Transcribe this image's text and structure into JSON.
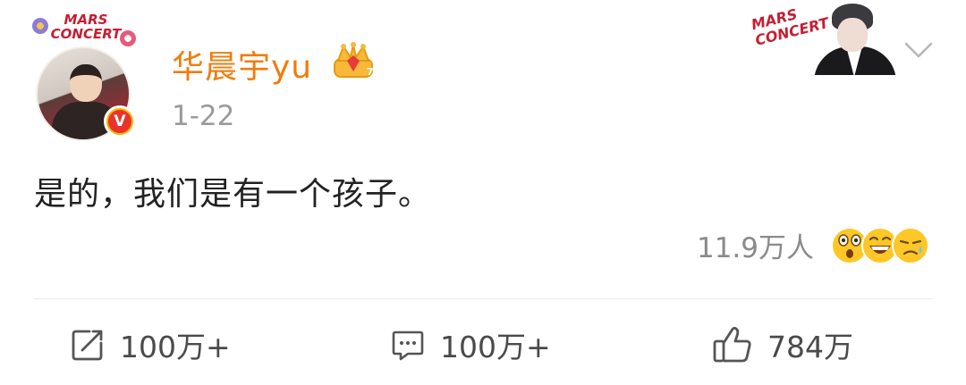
{
  "user": {
    "name": "华晨宇yu",
    "avatar_badge_text": "MARS CONCERT",
    "verified_letter": "V"
  },
  "post": {
    "timestamp": "1-22",
    "text": "是的，我们是有一个孩子。"
  },
  "header_badge": {
    "text": "MARS CONCERT"
  },
  "reactions": {
    "count": "11.9万人",
    "emojis": [
      "surprised-emoji-icon",
      "laughing-emoji-icon",
      "sad-emoji-icon"
    ]
  },
  "actions": {
    "repost": {
      "icon": "repost-icon",
      "label": "100万+"
    },
    "comment": {
      "icon": "comment-icon",
      "label": "100万+"
    },
    "like": {
      "icon": "thumbs-up-icon",
      "label": "784万"
    }
  },
  "colors": {
    "username": "#f07c0c",
    "verified_bg": "#e8342a",
    "verified_ring": "#f7b500",
    "emoji": "#fdc727",
    "brand_red": "#c71d32"
  }
}
